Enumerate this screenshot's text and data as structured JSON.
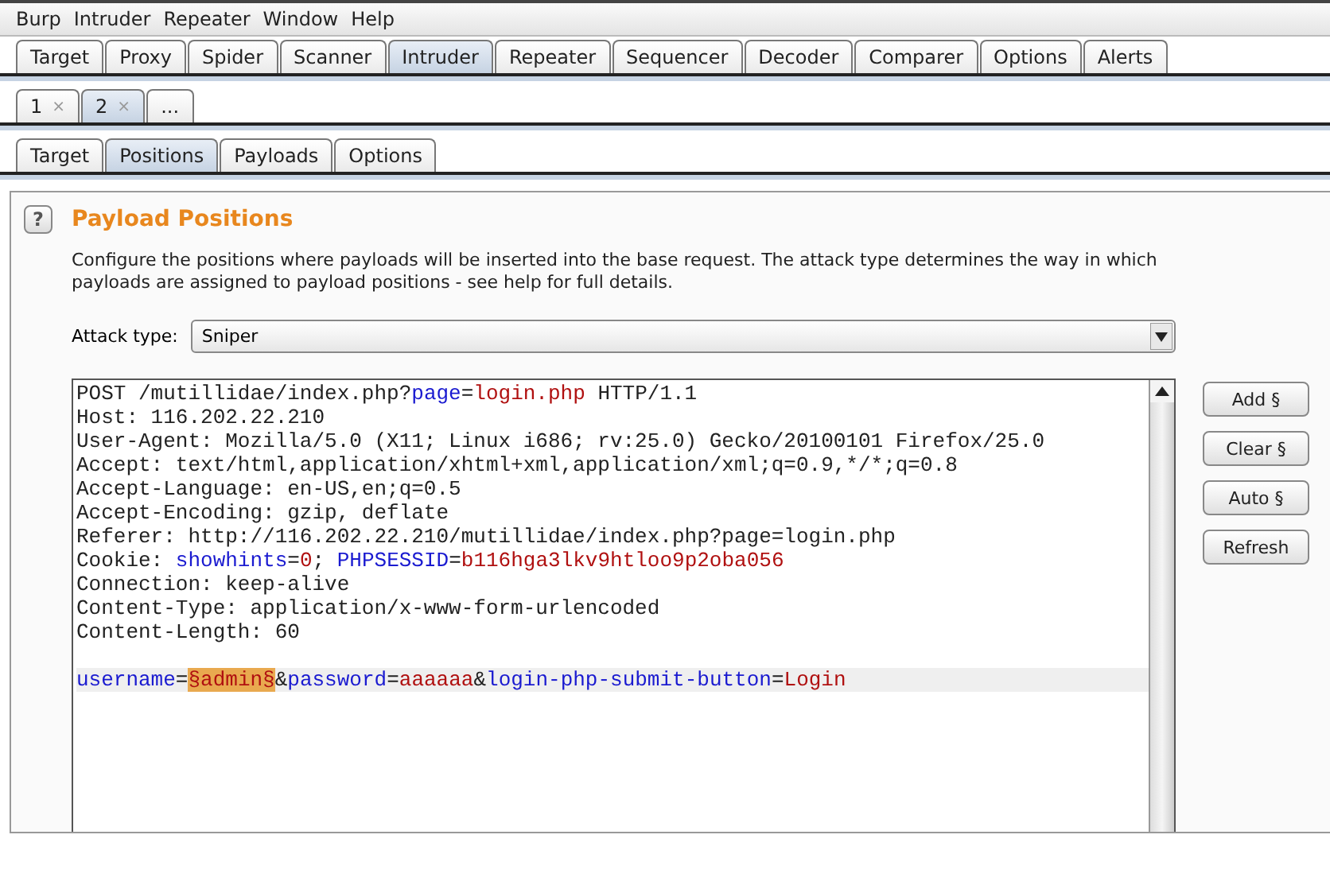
{
  "menu": [
    "Burp",
    "Intruder",
    "Repeater",
    "Window",
    "Help"
  ],
  "main_tabs": [
    {
      "label": "Target",
      "selected": false
    },
    {
      "label": "Proxy",
      "selected": false
    },
    {
      "label": "Spider",
      "selected": false
    },
    {
      "label": "Scanner",
      "selected": false
    },
    {
      "label": "Intruder",
      "selected": true
    },
    {
      "label": "Repeater",
      "selected": false
    },
    {
      "label": "Sequencer",
      "selected": false
    },
    {
      "label": "Decoder",
      "selected": false
    },
    {
      "label": "Comparer",
      "selected": false
    },
    {
      "label": "Options",
      "selected": false
    },
    {
      "label": "Alerts",
      "selected": false
    }
  ],
  "attack_tabs": [
    {
      "label": "1",
      "close": "×",
      "selected": false
    },
    {
      "label": "2",
      "close": "×",
      "selected": true
    },
    {
      "label": "...",
      "selected": false
    }
  ],
  "sub_tabs": [
    {
      "label": "Target",
      "selected": false
    },
    {
      "label": "Positions",
      "selected": true
    },
    {
      "label": "Payloads",
      "selected": false
    },
    {
      "label": "Options",
      "selected": false
    }
  ],
  "panel": {
    "help": "?",
    "title": "Payload Positions",
    "description": "Configure the positions where payloads will be inserted into the base request. The attack type determines the way in which payloads are assigned to payload positions - see help for full details.",
    "attack_type_label": "Attack type:",
    "attack_type": "Sniper"
  },
  "request_lines": [
    {
      "kind": "text",
      "current": false,
      "segments": [
        {
          "kind": "plain",
          "text": "POST /mutillidae/index.php?"
        },
        {
          "kind": "name",
          "text": "page"
        },
        {
          "kind": "plain",
          "text": "="
        },
        {
          "kind": "value",
          "text": "login.php"
        },
        {
          "kind": "plain",
          "text": " HTTP/1.1"
        }
      ]
    },
    {
      "kind": "text",
      "current": false,
      "segments": [
        {
          "kind": "plain",
          "text": "Host: 116.202.22.210"
        }
      ]
    },
    {
      "kind": "text",
      "current": false,
      "segments": [
        {
          "kind": "plain",
          "text": "User-Agent: Mozilla/5.0 (X11; Linux i686; rv:25.0) Gecko/20100101 Firefox/25.0"
        }
      ]
    },
    {
      "kind": "text",
      "current": false,
      "segments": [
        {
          "kind": "plain",
          "text": "Accept: text/html,application/xhtml+xml,application/xml;q=0.9,*/*;q=0.8"
        }
      ]
    },
    {
      "kind": "text",
      "current": false,
      "segments": [
        {
          "kind": "plain",
          "text": "Accept-Language: en-US,en;q=0.5"
        }
      ]
    },
    {
      "kind": "text",
      "current": false,
      "segments": [
        {
          "kind": "plain",
          "text": "Accept-Encoding: gzip, deflate"
        }
      ]
    },
    {
      "kind": "text",
      "current": false,
      "segments": [
        {
          "kind": "plain",
          "text": "Referer: http://116.202.22.210/mutillidae/index.php?page=login.php"
        }
      ]
    },
    {
      "kind": "text",
      "current": false,
      "segments": [
        {
          "kind": "plain",
          "text": "Cookie: "
        },
        {
          "kind": "name",
          "text": "showhints"
        },
        {
          "kind": "plain",
          "text": "="
        },
        {
          "kind": "value",
          "text": "0"
        },
        {
          "kind": "plain",
          "text": "; "
        },
        {
          "kind": "name",
          "text": "PHPSESSID"
        },
        {
          "kind": "plain",
          "text": "="
        },
        {
          "kind": "value",
          "text": "b116hga3lkv9htloo9p2oba056"
        }
      ]
    },
    {
      "kind": "text",
      "current": false,
      "segments": [
        {
          "kind": "plain",
          "text": "Connection: keep-alive"
        }
      ]
    },
    {
      "kind": "text",
      "current": false,
      "segments": [
        {
          "kind": "plain",
          "text": "Content-Type: application/x-www-form-urlencoded"
        }
      ]
    },
    {
      "kind": "text",
      "current": false,
      "segments": [
        {
          "kind": "plain",
          "text": "Content-Length: 60"
        }
      ]
    },
    {
      "kind": "blank",
      "current": false
    },
    {
      "kind": "text",
      "current": true,
      "segments": [
        {
          "kind": "name",
          "text": "username"
        },
        {
          "kind": "plain",
          "text": "="
        },
        {
          "kind": "payload",
          "text": "§admin§"
        },
        {
          "kind": "plain",
          "text": "&"
        },
        {
          "kind": "name",
          "text": "password"
        },
        {
          "kind": "plain",
          "text": "="
        },
        {
          "kind": "value",
          "text": "aaaaaa"
        },
        {
          "kind": "plain",
          "text": "&"
        },
        {
          "kind": "name",
          "text": "login-php-submit-button"
        },
        {
          "kind": "plain",
          "text": "="
        },
        {
          "kind": "value",
          "text": "Login"
        }
      ]
    }
  ],
  "buttons": [
    "Add §",
    "Clear §",
    "Auto §",
    "Refresh"
  ]
}
